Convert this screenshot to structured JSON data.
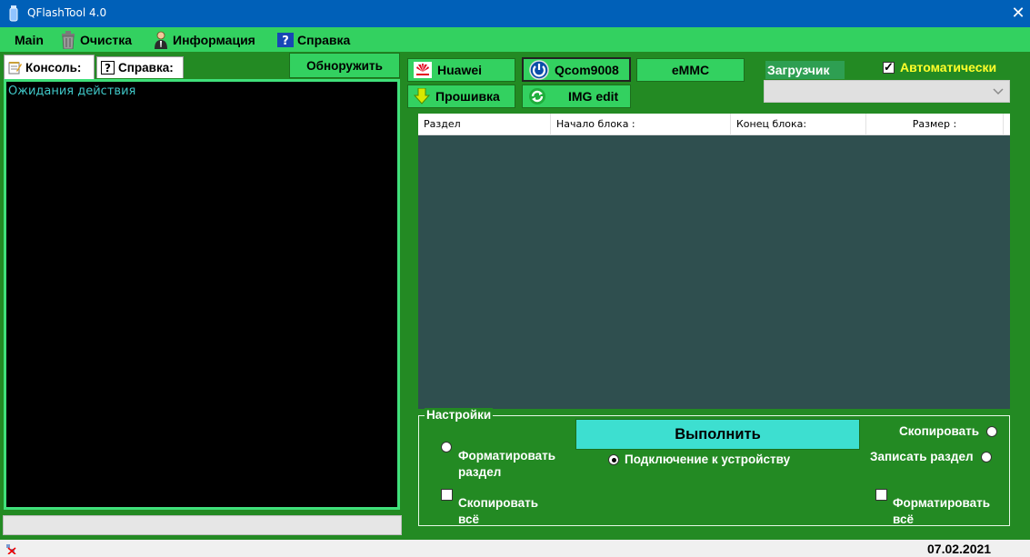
{
  "window": {
    "title": "QFlashTool 4.0",
    "close": "✕"
  },
  "menu": {
    "main": "Main",
    "clear": "Очистка",
    "info": "Информация",
    "help": "Справка"
  },
  "left": {
    "tabs": {
      "console": "Консоль:",
      "help": "Справка:"
    },
    "detect_button": "Обноружить",
    "console_text": "Ожидания действия"
  },
  "toolbar": {
    "huawei": "Huawei",
    "firmware": "Прошивка",
    "qcom": "Qcom9008",
    "img_edit": "IMG edit",
    "emmc": "eMMC",
    "loader_label": "Загрузчик",
    "auto_label": "Автоматически",
    "auto_checked": true,
    "loader_value": ""
  },
  "table": {
    "columns": [
      "Раздел",
      "Начало блока :",
      "Конец блока:",
      "Размер :"
    ],
    "rows": []
  },
  "settings": {
    "title": "Настройки",
    "run_button": "Выполнить",
    "format_partition_1": "Форматировать",
    "format_partition_2": "раздел",
    "copy_all_1": "Скопировать",
    "copy_all_2": "всё",
    "connect_device": "Подключение к устройству",
    "copy": "Скопировать",
    "write_partition": "Записать раздел",
    "format_all_1": "Форматировать",
    "format_all_2": "всё"
  },
  "status": {
    "date": "07.02.2021"
  },
  "colors": {
    "titlebar": "#0060b8",
    "menubar": "#33d160",
    "background": "#238a23",
    "button": "#33d160",
    "run_button": "#3ddfd0",
    "table_body": "#2f4f4f",
    "auto_label": "#ffff2a",
    "console_text": "#3fc6c6"
  }
}
